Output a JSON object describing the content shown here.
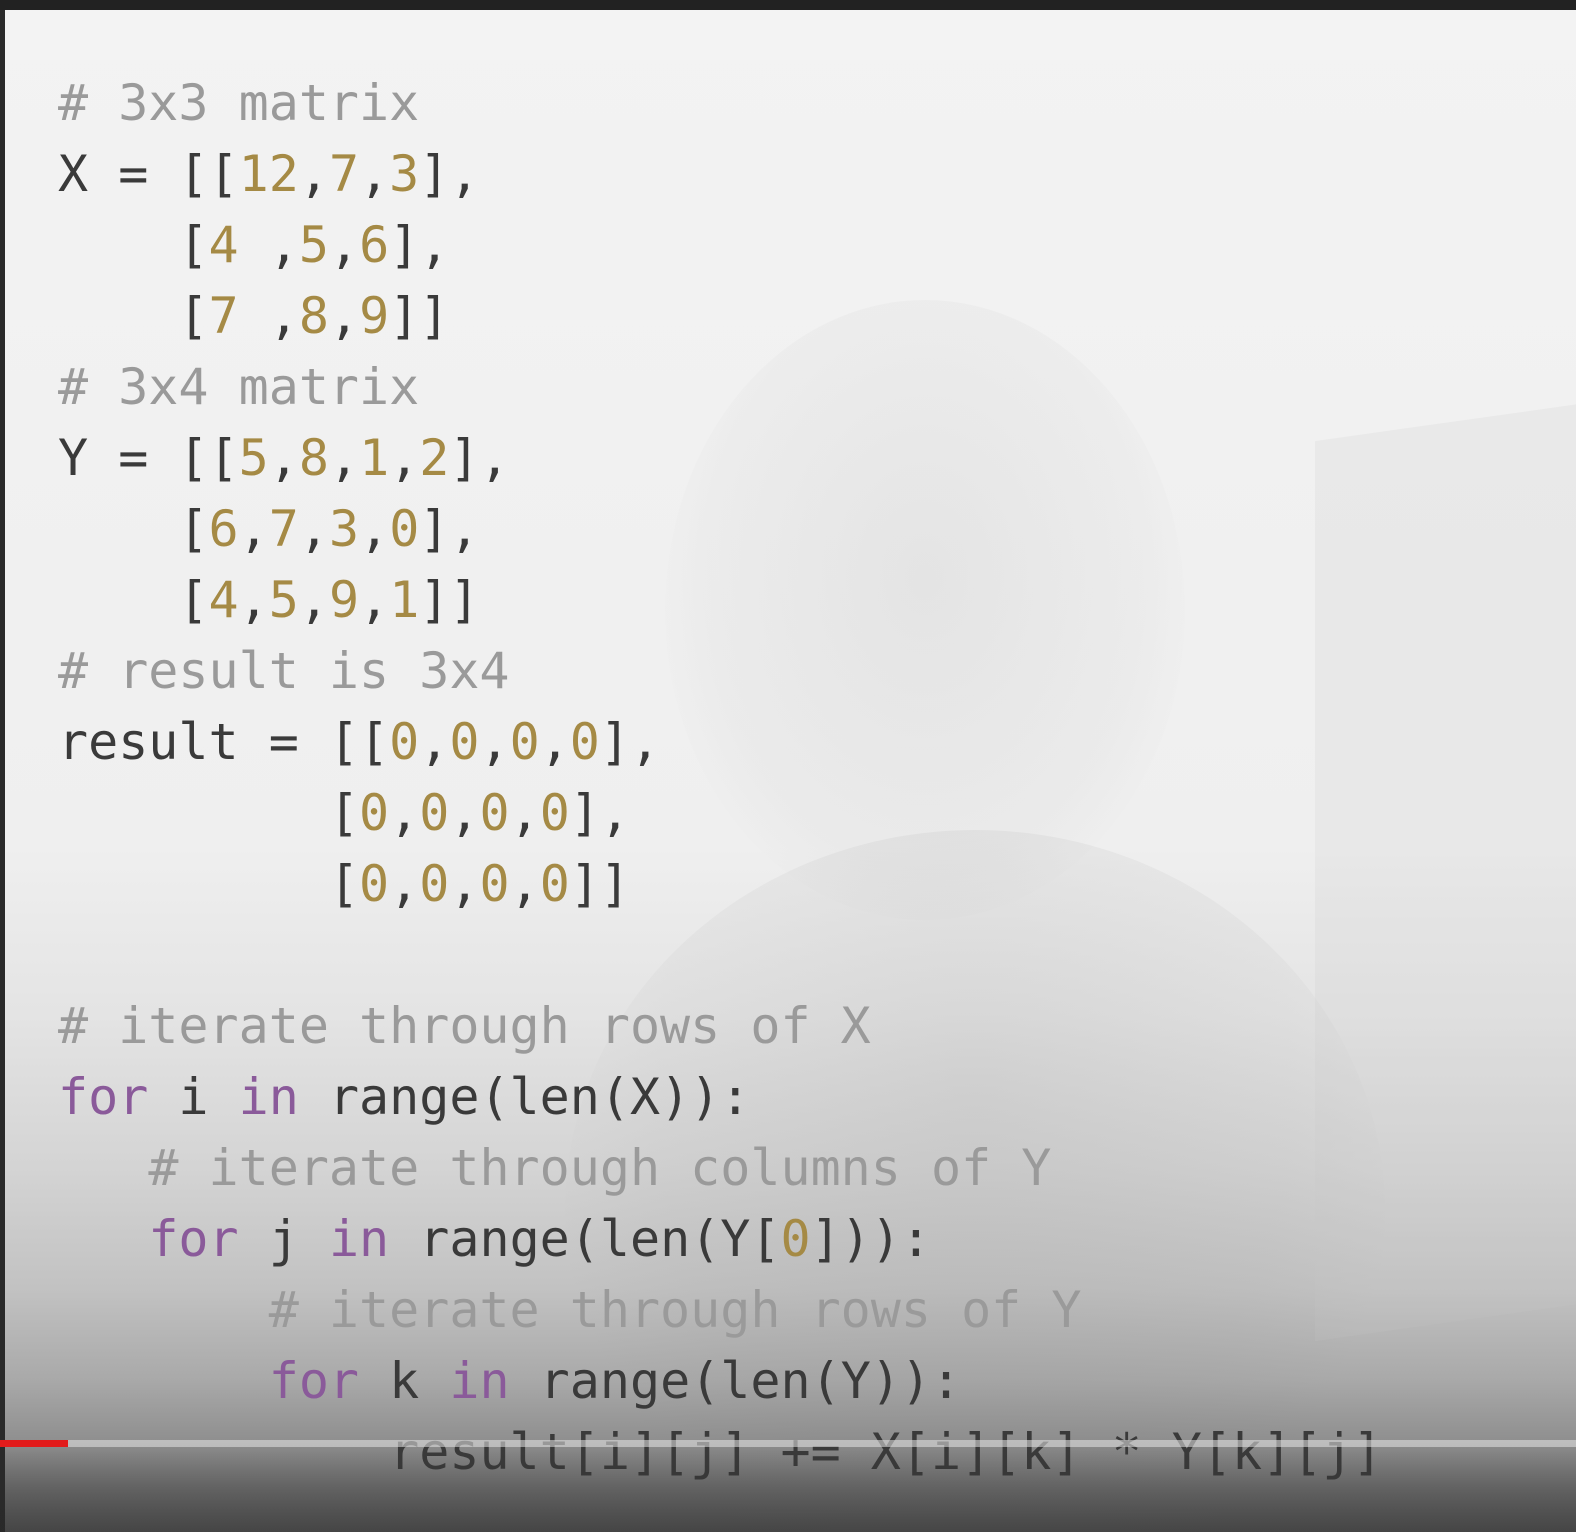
{
  "video": {
    "progress_fraction": 0.043,
    "progress_color": "#e21b1b"
  },
  "code_lines": [
    {
      "indent": "",
      "tokens": [
        {
          "t": "# 3x3 matrix",
          "k": "comment"
        }
      ]
    },
    {
      "indent": "",
      "tokens": [
        {
          "t": "X = [[",
          "k": "txt"
        },
        {
          "t": "12",
          "k": "num"
        },
        {
          "t": ",",
          "k": "txt"
        },
        {
          "t": "7",
          "k": "num"
        },
        {
          "t": ",",
          "k": "txt"
        },
        {
          "t": "3",
          "k": "num"
        },
        {
          "t": "],",
          "k": "txt"
        }
      ]
    },
    {
      "indent": "    ",
      "tokens": [
        {
          "t": "[",
          "k": "txt"
        },
        {
          "t": "4",
          "k": "num"
        },
        {
          "t": " ,",
          "k": "txt"
        },
        {
          "t": "5",
          "k": "num"
        },
        {
          "t": ",",
          "k": "txt"
        },
        {
          "t": "6",
          "k": "num"
        },
        {
          "t": "],",
          "k": "txt"
        }
      ]
    },
    {
      "indent": "    ",
      "tokens": [
        {
          "t": "[",
          "k": "txt"
        },
        {
          "t": "7",
          "k": "num"
        },
        {
          "t": " ,",
          "k": "txt"
        },
        {
          "t": "8",
          "k": "num"
        },
        {
          "t": ",",
          "k": "txt"
        },
        {
          "t": "9",
          "k": "num"
        },
        {
          "t": "]]",
          "k": "txt"
        }
      ]
    },
    {
      "indent": "",
      "tokens": [
        {
          "t": "# 3x4 matrix",
          "k": "comment"
        }
      ]
    },
    {
      "indent": "",
      "tokens": [
        {
          "t": "Y = [[",
          "k": "txt"
        },
        {
          "t": "5",
          "k": "num"
        },
        {
          "t": ",",
          "k": "txt"
        },
        {
          "t": "8",
          "k": "num"
        },
        {
          "t": ",",
          "k": "txt"
        },
        {
          "t": "1",
          "k": "num"
        },
        {
          "t": ",",
          "k": "txt"
        },
        {
          "t": "2",
          "k": "num"
        },
        {
          "t": "],",
          "k": "txt"
        }
      ]
    },
    {
      "indent": "    ",
      "tokens": [
        {
          "t": "[",
          "k": "txt"
        },
        {
          "t": "6",
          "k": "num"
        },
        {
          "t": ",",
          "k": "txt"
        },
        {
          "t": "7",
          "k": "num"
        },
        {
          "t": ",",
          "k": "txt"
        },
        {
          "t": "3",
          "k": "num"
        },
        {
          "t": ",",
          "k": "txt"
        },
        {
          "t": "0",
          "k": "num"
        },
        {
          "t": "],",
          "k": "txt"
        }
      ]
    },
    {
      "indent": "    ",
      "tokens": [
        {
          "t": "[",
          "k": "txt"
        },
        {
          "t": "4",
          "k": "num"
        },
        {
          "t": ",",
          "k": "txt"
        },
        {
          "t": "5",
          "k": "num"
        },
        {
          "t": ",",
          "k": "txt"
        },
        {
          "t": "9",
          "k": "num"
        },
        {
          "t": ",",
          "k": "txt"
        },
        {
          "t": "1",
          "k": "num"
        },
        {
          "t": "]]",
          "k": "txt"
        }
      ]
    },
    {
      "indent": "",
      "tokens": [
        {
          "t": "# result is 3x4",
          "k": "comment"
        }
      ]
    },
    {
      "indent": "",
      "tokens": [
        {
          "t": "result = [[",
          "k": "txt"
        },
        {
          "t": "0",
          "k": "num"
        },
        {
          "t": ",",
          "k": "txt"
        },
        {
          "t": "0",
          "k": "num"
        },
        {
          "t": ",",
          "k": "txt"
        },
        {
          "t": "0",
          "k": "num"
        },
        {
          "t": ",",
          "k": "txt"
        },
        {
          "t": "0",
          "k": "num"
        },
        {
          "t": "],",
          "k": "txt"
        }
      ]
    },
    {
      "indent": "         ",
      "tokens": [
        {
          "t": "[",
          "k": "txt"
        },
        {
          "t": "0",
          "k": "num"
        },
        {
          "t": ",",
          "k": "txt"
        },
        {
          "t": "0",
          "k": "num"
        },
        {
          "t": ",",
          "k": "txt"
        },
        {
          "t": "0",
          "k": "num"
        },
        {
          "t": ",",
          "k": "txt"
        },
        {
          "t": "0",
          "k": "num"
        },
        {
          "t": "],",
          "k": "txt"
        }
      ]
    },
    {
      "indent": "         ",
      "tokens": [
        {
          "t": "[",
          "k": "txt"
        },
        {
          "t": "0",
          "k": "num"
        },
        {
          "t": ",",
          "k": "txt"
        },
        {
          "t": "0",
          "k": "num"
        },
        {
          "t": ",",
          "k": "txt"
        },
        {
          "t": "0",
          "k": "num"
        },
        {
          "t": ",",
          "k": "txt"
        },
        {
          "t": "0",
          "k": "num"
        },
        {
          "t": "]]",
          "k": "txt"
        }
      ]
    },
    {
      "indent": "",
      "tokens": []
    },
    {
      "indent": "",
      "tokens": [
        {
          "t": "# iterate through rows of X",
          "k": "comment"
        }
      ]
    },
    {
      "indent": "",
      "tokens": [
        {
          "t": "for",
          "k": "kw"
        },
        {
          "t": " i ",
          "k": "txt"
        },
        {
          "t": "in",
          "k": "kw"
        },
        {
          "t": " range(len(X)):",
          "k": "txt"
        }
      ]
    },
    {
      "indent": "   ",
      "tokens": [
        {
          "t": "# iterate through columns of Y",
          "k": "comment"
        }
      ]
    },
    {
      "indent": "   ",
      "tokens": [
        {
          "t": "for",
          "k": "kw"
        },
        {
          "t": " j ",
          "k": "txt"
        },
        {
          "t": "in",
          "k": "kw"
        },
        {
          "t": " range(len(Y[",
          "k": "txt"
        },
        {
          "t": "0",
          "k": "num"
        },
        {
          "t": "])):",
          "k": "txt"
        }
      ]
    },
    {
      "indent": "       ",
      "tokens": [
        {
          "t": "# iterate through rows of Y",
          "k": "comment"
        }
      ]
    },
    {
      "indent": "       ",
      "tokens": [
        {
          "t": "for",
          "k": "kw"
        },
        {
          "t": " k ",
          "k": "txt"
        },
        {
          "t": "in",
          "k": "kw"
        },
        {
          "t": " range(len(Y)):",
          "k": "txt"
        }
      ]
    },
    {
      "indent": "           ",
      "tokens": [
        {
          "t": "result[i][j] += X[i][k] * Y[k][j]",
          "k": "txt"
        }
      ]
    }
  ],
  "colors": {
    "keyword": "#8a5a9a",
    "number": "#a58a45",
    "comment": "#9a9a9a",
    "text": "#3a3a3a"
  }
}
